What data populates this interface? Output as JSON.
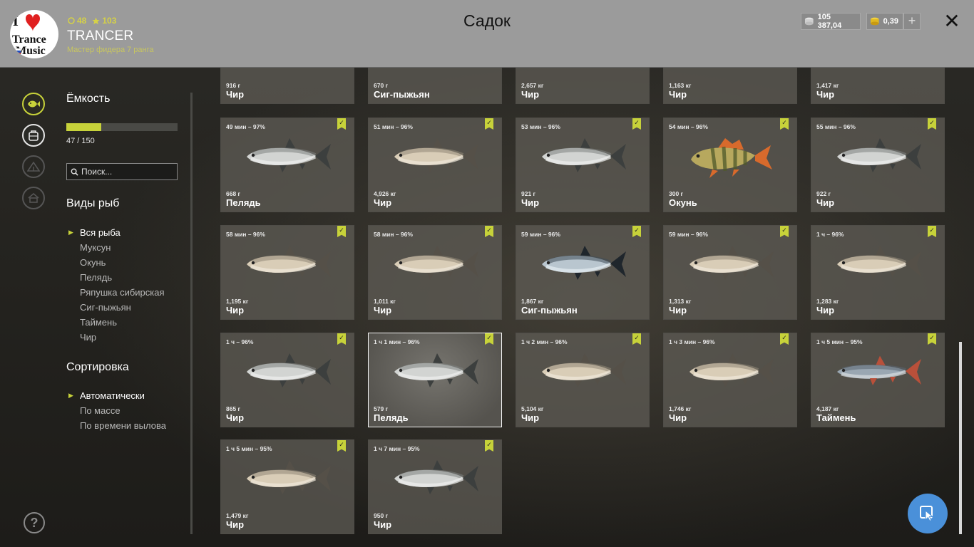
{
  "header": {
    "title": "Садок",
    "avatar_text": [
      "Trance",
      "Music"
    ],
    "stats": {
      "coins_small": "48",
      "stars": "103"
    },
    "username": "TRANCER",
    "rank": "Мастер фидера 7 ранга",
    "silver": "105 387,04",
    "gold": "0,39",
    "plus_label": "+",
    "close_label": "✕"
  },
  "sidebar": {
    "capacity_title": "Ёмкость",
    "capacity_used": 47,
    "capacity_max": 150,
    "capacity_text": "47 / 150",
    "search_placeholder": "Поиск...",
    "species_title": "Виды рыб",
    "species": [
      "Вся рыба",
      "Муксун",
      "Окунь",
      "Пелядь",
      "Ряпушка сибирская",
      "Сиг-пыжьян",
      "Таймень",
      "Чир"
    ],
    "species_active": 0,
    "sort_title": "Сортировка",
    "sort": [
      "Автоматически",
      "По массе",
      "По времени вылова"
    ],
    "sort_active": 0,
    "help_label": "?"
  },
  "fish": [
    {
      "time": "",
      "weight": "916 г",
      "name": "Чир",
      "kind": "pale"
    },
    {
      "time": "",
      "weight": "670 г",
      "name": "Сиг-пыжьян",
      "kind": "silver"
    },
    {
      "time": "",
      "weight": "2,657 кг",
      "name": "Чир",
      "kind": "pale"
    },
    {
      "time": "",
      "weight": "1,163 кг",
      "name": "Чир",
      "kind": "pale"
    },
    {
      "time": "",
      "weight": "1,417 кг",
      "name": "Чир",
      "kind": "pale"
    },
    {
      "time": "49 мин – 97%",
      "weight": "668 г",
      "name": "Пелядь",
      "kind": "silver"
    },
    {
      "time": "51 мин – 96%",
      "weight": "4,926 кг",
      "name": "Чир",
      "kind": "pale"
    },
    {
      "time": "53 мин – 96%",
      "weight": "921 г",
      "name": "Чир",
      "kind": "silver"
    },
    {
      "time": "54 мин – 96%",
      "weight": "300 г",
      "name": "Окунь",
      "kind": "perch"
    },
    {
      "time": "55 мин – 96%",
      "weight": "922 г",
      "name": "Чир",
      "kind": "silver"
    },
    {
      "time": "58 мин – 96%",
      "weight": "1,195 кг",
      "name": "Чир",
      "kind": "pale"
    },
    {
      "time": "58 мин – 96%",
      "weight": "1,011 кг",
      "name": "Чир",
      "kind": "pale"
    },
    {
      "time": "59 мин – 96%",
      "weight": "1,867 кг",
      "name": "Сиг-пыжьян",
      "kind": "dark"
    },
    {
      "time": "59 мин – 96%",
      "weight": "1,313 кг",
      "name": "Чир",
      "kind": "pale"
    },
    {
      "time": "1 ч – 96%",
      "weight": "1,283 кг",
      "name": "Чир",
      "kind": "pale"
    },
    {
      "time": "1 ч – 96%",
      "weight": "865 г",
      "name": "Чир",
      "kind": "silver"
    },
    {
      "time": "1 ч 1 мин – 96%",
      "weight": "579 г",
      "name": "Пелядь",
      "kind": "silver",
      "selected": true
    },
    {
      "time": "1 ч 2 мин – 96%",
      "weight": "5,104 кг",
      "name": "Чир",
      "kind": "pale"
    },
    {
      "time": "1 ч 3 мин – 96%",
      "weight": "1,746 кг",
      "name": "Чир",
      "kind": "pale"
    },
    {
      "time": "1 ч 5 мин – 95%",
      "weight": "4,187 кг",
      "name": "Таймень",
      "kind": "taimen"
    },
    {
      "time": "1 ч 5 мин – 95%",
      "weight": "1,479 кг",
      "name": "Чир",
      "kind": "pale"
    },
    {
      "time": "1 ч 7 мин – 95%",
      "weight": "950 г",
      "name": "Чир",
      "kind": "silver"
    }
  ],
  "colors": {
    "accent": "#c7d23a",
    "header_bg": "#9b9b9b",
    "cursor_button": "#4a90d9"
  }
}
